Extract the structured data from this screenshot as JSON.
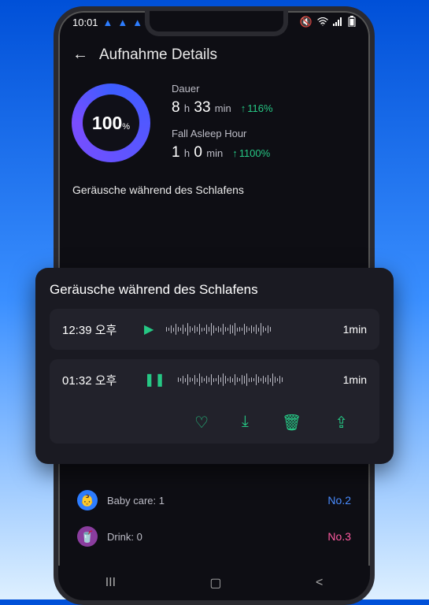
{
  "status": {
    "time": "10:01",
    "bell_icon": "bell-icon"
  },
  "header": {
    "title": "Aufnahme Details"
  },
  "score": {
    "value": "100",
    "percent_sign": "%"
  },
  "duration": {
    "label": "Dauer",
    "h": "8",
    "h_unit": "h",
    "m": "33",
    "m_unit": "min",
    "change": "116%"
  },
  "fall_asleep": {
    "label": "Fall Asleep Hour",
    "h": "1",
    "h_unit": "h",
    "m": "0",
    "m_unit": "min",
    "change": "1100%"
  },
  "section_noise_title": "Geräusche während des Schlafens",
  "sheet": {
    "title": "Geräusche während des Schlafens",
    "clips": [
      {
        "time": "12:39 오후",
        "state": "play",
        "duration": "1min"
      },
      {
        "time": "01:32 오후",
        "state": "pause",
        "duration": "1min"
      }
    ],
    "actions": {
      "favorite": "heart-icon",
      "download": "download-icon",
      "delete": "trash-icon",
      "share": "share-icon"
    }
  },
  "list": [
    {
      "icon": "baby-icon",
      "icon_bg": "#2d7dff",
      "glyph": "👶",
      "label": "Baby care:",
      "count": "1",
      "rank": "No.2",
      "rank_color": "blue"
    },
    {
      "icon": "drink-icon",
      "icon_bg": "#8a3d9e",
      "glyph": "🥤",
      "label": "Drink:",
      "count": "0",
      "rank": "No.3",
      "rank_color": "pink"
    }
  ]
}
